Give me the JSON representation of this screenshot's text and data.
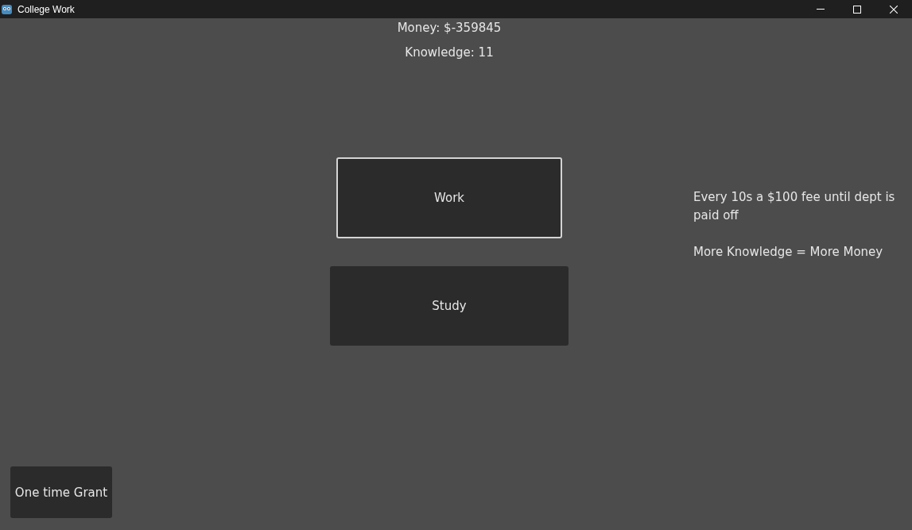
{
  "window": {
    "title": "College Work"
  },
  "stats": [
    "Money: $-359845",
    "Knowledge: 11"
  ],
  "actions": [
    {
      "label": "Work",
      "focused": true
    },
    {
      "label": "Study",
      "focused": false
    }
  ],
  "info": [
    "Every 10s a $100 fee until dept is paid off",
    "More Knowledge = More Money"
  ],
  "grant_button": {
    "label": "One time Grant",
    "focused": false
  }
}
